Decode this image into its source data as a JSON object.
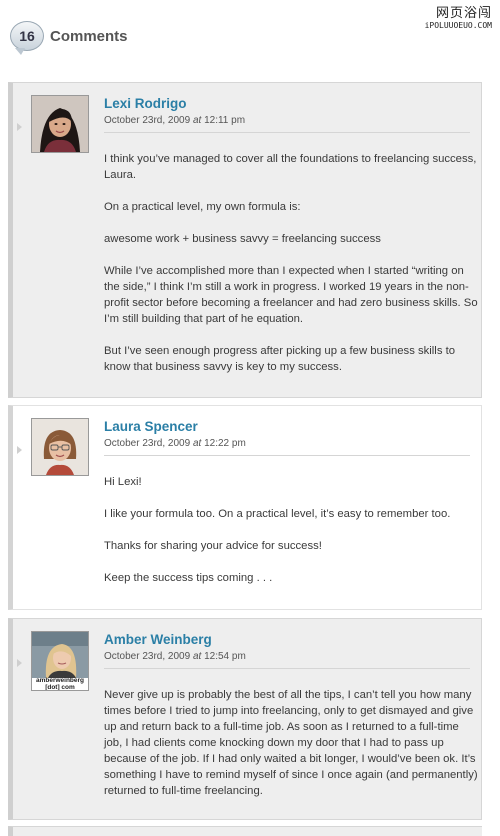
{
  "watermark": {
    "site_name": "网页浴闯",
    "site_url": "iPOLUUOEUO.COM"
  },
  "header": {
    "count": "16",
    "title": "Comments"
  },
  "comments": [
    {
      "author": "Lexi Rodrigo",
      "date": "October 23rd, 2009",
      "at": "at",
      "time": "12:11 pm",
      "paragraphs": [
        "I think you’ve managed to cover all the foundations to freelancing success, Laura.",
        "On a practical level, my own formula is:",
        "awesome work + business savvy = freelancing success",
        "While I’ve accomplished more than I expected when I started “writing on the side,” I think I’m still a work in progress. I worked 19 years in the non-profit sector before becoming a freelancer and had zero business skills. So I’m still building that part of he equation.",
        "But I’ve seen enough progress after picking up a few business skills to know that business savvy is key to my success."
      ]
    },
    {
      "author": "Laura Spencer",
      "date": "October 23rd, 2009",
      "at": "at",
      "time": "12:22 pm",
      "paragraphs": [
        "Hi Lexi!",
        "I like your formula too. On a practical level, it’s easy to remember too.",
        "Thanks for sharing your advice for success!",
        "Keep the success tips coming . . ."
      ]
    },
    {
      "author": "Amber Weinberg",
      "date": "October 23rd, 2009",
      "at": "at",
      "time": "12:54 pm",
      "avatar_caption": "amberweinberg [dot] com",
      "paragraphs": [
        "Never give up is probably the best of all the tips, I can’t tell you how many times before I tried to jump into freelancing, only to get dismayed and give up and return back to a full-time job. As soon as I returned to a full-time job, I had clients come knocking down my door that I had to pass up because of the job. If I had only waited a bit longer, I would’ve been ok. It’s something I have to remind myself of since I once again (and permanently) returned to full-time freelancing."
      ]
    }
  ]
}
